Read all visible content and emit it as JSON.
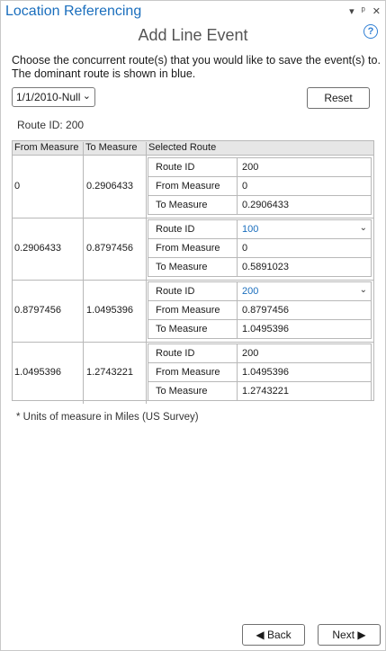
{
  "window": {
    "title": "Location Referencing",
    "icons": [
      "chevron-down-icon",
      "pin-icon",
      "close-icon"
    ]
  },
  "panel": {
    "title": "Add Line Event",
    "help_icon": "?"
  },
  "instructions": "Choose the concurrent route(s) that you would like to save the event(s) to. The dominant route is shown in blue.",
  "date_select": {
    "value": "1/1/2010-Null"
  },
  "reset_label": "Reset",
  "route_id_line": "Route ID: 200",
  "table": {
    "headers": [
      "From Measure",
      "To Measure",
      "Selected Route"
    ],
    "row_labels": [
      "Route ID",
      "From Measure",
      "To Measure"
    ],
    "groups": [
      {
        "from": "0",
        "to": "0.2906433",
        "route_id": "200",
        "route_from": "0",
        "route_to": "0.2906433"
      },
      {
        "from": "0.2906433",
        "to": "0.8797456",
        "route_id": "100",
        "route_from": "0",
        "route_to": "0.5891023"
      },
      {
        "from": "0.8797456",
        "to": "1.0495396",
        "route_id": "200",
        "route_from": "0.8797456",
        "route_to": "1.0495396"
      },
      {
        "from": "1.0495396",
        "to": "1.2743221",
        "route_id": "200",
        "route_from": "1.0495396",
        "route_to": "1.2743221"
      }
    ]
  },
  "note": "* Units of measure in Miles (US Survey)",
  "buttons": {
    "back": "Back",
    "next": "Next"
  },
  "colors": {
    "accent": "#1a6ebd"
  }
}
